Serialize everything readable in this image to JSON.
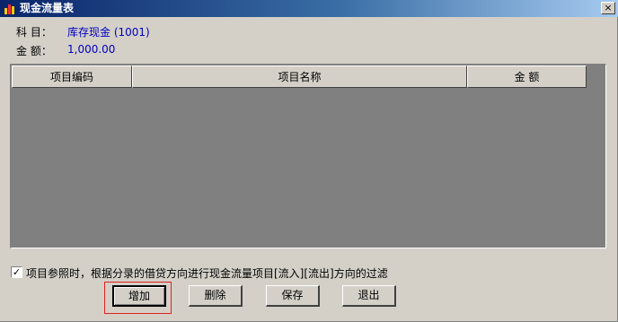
{
  "window": {
    "title": "现金流量表",
    "close_symbol": "×"
  },
  "account": {
    "label": "科 目：",
    "value": "库存现金 (1001)"
  },
  "amount": {
    "label": "金 额：",
    "value": "1,000.00"
  },
  "grid": {
    "columns": [
      "项目编码",
      "项目名称",
      "金 额"
    ],
    "rows": []
  },
  "filter": {
    "checked": true,
    "check_symbol": "✓",
    "label": "项目参照时，根据分录的借贷方向进行现金流量项目[流入][流出]方向的过滤"
  },
  "buttons": {
    "add": "增加",
    "delete": "删除",
    "save": "保存",
    "exit": "退出"
  },
  "colors": {
    "title_start": "#0a246a",
    "title_end": "#a6caf0",
    "value_text": "#0000c0",
    "grid_bg": "#808080",
    "highlight": "#e02020"
  }
}
